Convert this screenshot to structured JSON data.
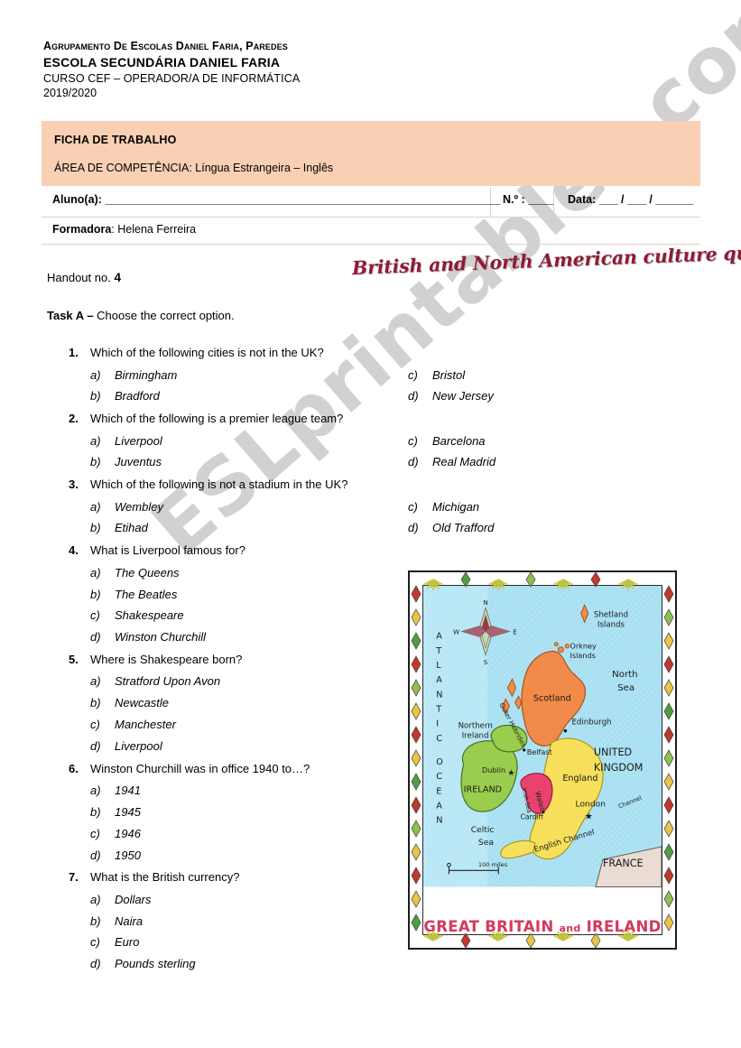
{
  "header": {
    "line1": "Agrupamento de Escolas Daniel Faria, Paredes",
    "line2": "ESCOLA SECUNDÁRIA DANIEL FARIA",
    "line3": "CURSO CEF – OPERADOR/A DE INFORMÁTICA",
    "line4": "2019/2020"
  },
  "info_box": {
    "title": "FICHA DE TRABALHO",
    "area": "ÁREA DE COMPETÊNCIA: Língua Estrangeira – Inglês",
    "bg_color": "#FAD0B4"
  },
  "student_row": {
    "aluno_label": "Aluno(a): _______________________________________________________________",
    "numero_label": "N.º : ____",
    "data_label": "Data: ___ / ___ / ______"
  },
  "trainer_row": {
    "label": "Formadora",
    "separator": ": ",
    "name": "Helena Ferreira"
  },
  "handout": {
    "label": "Handout no. ",
    "number": "4"
  },
  "quiz_title": {
    "text": "British and North American culture quiz",
    "color": "#8E1B36"
  },
  "task": {
    "label": "Task A – ",
    "instruction": "Choose the correct option."
  },
  "watermark": {
    "text": "ESLprintables.com",
    "color": "#C9C9C9"
  },
  "questions": [
    {
      "number": "1.",
      "text": "Which of the following cities is not in the UK?",
      "layout": "two-column",
      "options": [
        {
          "label": "a)",
          "text": "Birmingham"
        },
        {
          "label": "b)",
          "text": "Bradford"
        },
        {
          "label": "c)",
          "text": "Bristol"
        },
        {
          "label": "d)",
          "text": "New Jersey"
        }
      ]
    },
    {
      "number": "2.",
      "text": "Which of the following is a premier league team?",
      "layout": "two-column",
      "options": [
        {
          "label": "a)",
          "text": "Liverpool"
        },
        {
          "label": "b)",
          "text": "Juventus"
        },
        {
          "label": "c)",
          "text": "Barcelona"
        },
        {
          "label": "d)",
          "text": "Real Madrid"
        }
      ]
    },
    {
      "number": "3.",
      "text": "Which of the following is not a stadium in the UK?",
      "layout": "two-column",
      "options": [
        {
          "label": "a)",
          "text": "Wembley"
        },
        {
          "label": "b)",
          "text": "Etihad"
        },
        {
          "label": "c)",
          "text": "Michigan"
        },
        {
          "label": "d)",
          "text": "Old Trafford"
        }
      ]
    },
    {
      "number": "4.",
      "text": "What is Liverpool famous for?",
      "layout": "one-column",
      "options": [
        {
          "label": "a)",
          "text": "The Queens"
        },
        {
          "label": "b)",
          "text": "The Beatles"
        },
        {
          "label": "c)",
          "text": "Shakespeare"
        },
        {
          "label": "d)",
          "text": "Winston Churchill"
        }
      ]
    },
    {
      "number": "5.",
      "text": "Where is Shakespeare born?",
      "layout": "one-column",
      "options": [
        {
          "label": "a)",
          "text": "Stratford Upon Avon"
        },
        {
          "label": "b)",
          "text": "Newcastle"
        },
        {
          "label": "c)",
          "text": "Manchester"
        },
        {
          "label": "d)",
          "text": "Liverpool"
        }
      ]
    },
    {
      "number": "6.",
      "text": "Winston Churchill was in office 1940 to…?",
      "layout": "one-column",
      "options": [
        {
          "label": "a)",
          "text": "1941"
        },
        {
          "label": "b)",
          "text": "1945"
        },
        {
          "label": "c)",
          "text": "1946"
        },
        {
          "label": "d)",
          "text": "1950"
        }
      ]
    },
    {
      "number": "7.",
      "text": "What is the British currency?",
      "layout": "one-column",
      "options": [
        {
          "label": "a)",
          "text": "Dollars"
        },
        {
          "label": "b)",
          "text": "Naira"
        },
        {
          "label": "c)",
          "text": "Euro"
        },
        {
          "label": "d)",
          "text": "Pounds sterling"
        }
      ]
    }
  ],
  "map": {
    "caption_left": "GREAT BRITAIN",
    "caption_mid": "and",
    "caption_right": "IRELAND",
    "caption_color": "#D4385F",
    "scale_label": "100 miles",
    "compass": {
      "n": "N",
      "e": "E",
      "s": "S",
      "w": "W"
    },
    "ocean_labels": [
      "ATLANTIC",
      "OCEAN",
      "North Sea",
      "Celtic Sea",
      "Irish Sea",
      "English Channel"
    ],
    "labels": [
      {
        "name": "Shetland Islands"
      },
      {
        "name": "Orkney Islands"
      },
      {
        "name": "Outer Hebrides"
      },
      {
        "name": "Scotland"
      },
      {
        "name": "Edinburgh"
      },
      {
        "name": "Northern Ireland"
      },
      {
        "name": "UNITED KINGDOM"
      },
      {
        "name": "Belfast"
      },
      {
        "name": "Dublin"
      },
      {
        "name": "IRELAND"
      },
      {
        "name": "Wales"
      },
      {
        "name": "England"
      },
      {
        "name": "Cardiff"
      },
      {
        "name": "London"
      },
      {
        "name": "Channel"
      },
      {
        "name": "FRANCE"
      }
    ],
    "colors": {
      "sea": "#9FDDF0",
      "scotland": "#F28B49",
      "england": "#F7E05B",
      "wales": "#E8436E",
      "ireland": "#8DC63F",
      "france": "#E7D7CE"
    }
  }
}
